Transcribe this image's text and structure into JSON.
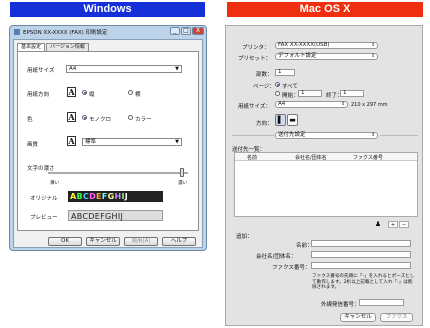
{
  "headers": {
    "windows": "Windows",
    "mac": "Mac OS X"
  },
  "win": {
    "title": "EPSON XX-XXXX (FAX) 印刷設定",
    "title_buttons": [
      "_",
      "□",
      "X"
    ],
    "tabs": [
      "基本設定",
      "バージョン情報"
    ],
    "paper_size": {
      "label": "用紙サイズ",
      "value": "A4"
    },
    "orientation": {
      "label": "用紙方向",
      "options": [
        "縦",
        "横"
      ],
      "selected": 0
    },
    "color": {
      "label": "色",
      "options": [
        "モノクロ",
        "カラー"
      ],
      "selected": 0
    },
    "quality": {
      "label": "画質",
      "value": "標準"
    },
    "density": {
      "label": "文字の濃さ",
      "light": "薄い",
      "dark": "濃い",
      "level": 0.97
    },
    "original": {
      "label": "オリジナル",
      "sample": "ABCDEFGHIJ"
    },
    "preview": {
      "label": "プレビュー",
      "sample": "ABCDEFGHIJ"
    },
    "buttons": [
      "OK",
      "キャンセル",
      "適用(A)",
      "ヘルプ"
    ]
  },
  "mac": {
    "printer": {
      "label": "プリンタ：",
      "value": "FAX XX-XXXX(USB)"
    },
    "preset": {
      "label": "プリセット：",
      "value": "デフォルト設定"
    },
    "copies": {
      "label": "部数：",
      "value": "1"
    },
    "pages": {
      "label": "ページ：",
      "all": "すべて",
      "from_label": "開始：",
      "from": "1",
      "to_label": "終了：",
      "to": "1"
    },
    "paper": {
      "label": "用紙サイズ：",
      "value": "A4",
      "dims": "210 x 297 mm"
    },
    "orientation": {
      "label": "方向："
    },
    "section": {
      "value": "送付先設定"
    },
    "recipients": {
      "label": "送付先一覧：",
      "columns": [
        "名前",
        "会社名/団体名",
        "ファクス番号"
      ]
    },
    "list_buttons": [
      "+",
      "−"
    ],
    "add": {
      "label": "追加：",
      "name": "名前：",
      "company": "会社名/団体名：",
      "fax": "ファクス番号："
    },
    "note": "ファクス番号の先頭に「-」を入れるとポーズとして動作します。2桁以上記載として入れ「-」は削除されます。",
    "prefix": {
      "label": "外線発信番号："
    },
    "buttons": [
      "キャンセル",
      "ファクス"
    ]
  }
}
